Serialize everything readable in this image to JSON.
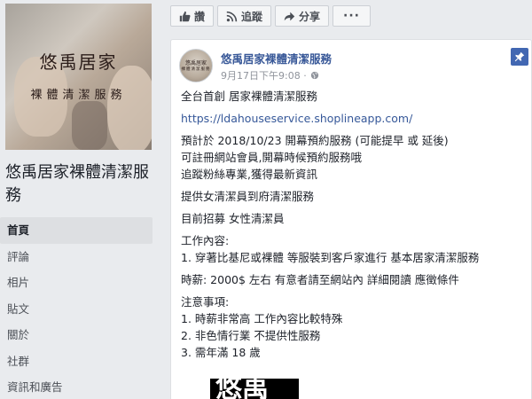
{
  "cover": {
    "logo_title": "悠禹居家",
    "logo_subtitle": "裸體清潔服務"
  },
  "page": {
    "name": "悠禹居家裸體清潔服務"
  },
  "nav": {
    "items": [
      {
        "label": "首頁",
        "active": true
      },
      {
        "label": "評論"
      },
      {
        "label": "相片"
      },
      {
        "label": "貼文"
      },
      {
        "label": "關於"
      },
      {
        "label": "社群"
      },
      {
        "label": "資訊和廣告"
      }
    ]
  },
  "actions": {
    "like": "讚",
    "follow": "追蹤",
    "share": "分享",
    "more": "···"
  },
  "post": {
    "author": "悠禹居家裸體清潔服務",
    "avatar_line1": "悠禹居家",
    "avatar_line2": "裸體清潔服務",
    "time": "9月17日下午9:08 ·",
    "lines": {
      "l1": "全台首創 居家裸體清潔服務",
      "l2": "https://ldahouseservice.shoplineapp.com/",
      "l3": "預計於 2018/10/23 開幕預約服務 (可能提早 或 延後)",
      "l4": "可註冊網站會員,開幕時候預約服務哦",
      "l5": "追蹤粉絲專業,獲得最新資訊",
      "l6": "提供女清潔員到府清潔服務",
      "l7": "目前招募 女性清潔員",
      "l8": "工作內容:",
      "l9": "1. 穿著比基尼或裸體 等服裝到客戶家進行 基本居家清潔服務",
      "l10": "時薪: 2000$ 左右 有意者請至網站內 詳細閱讀 應徵條件",
      "l11": "注意事項:",
      "l12": "1. 時薪非常高 工作內容比較特殊",
      "l13": "2. 非色情行業 不提供性服務",
      "l14": "3. 需年滿 18 歲"
    },
    "image_text": "悠禹"
  },
  "colors": {
    "link": "#385898",
    "pin": "#4267b2",
    "background": "#e9ebee"
  }
}
